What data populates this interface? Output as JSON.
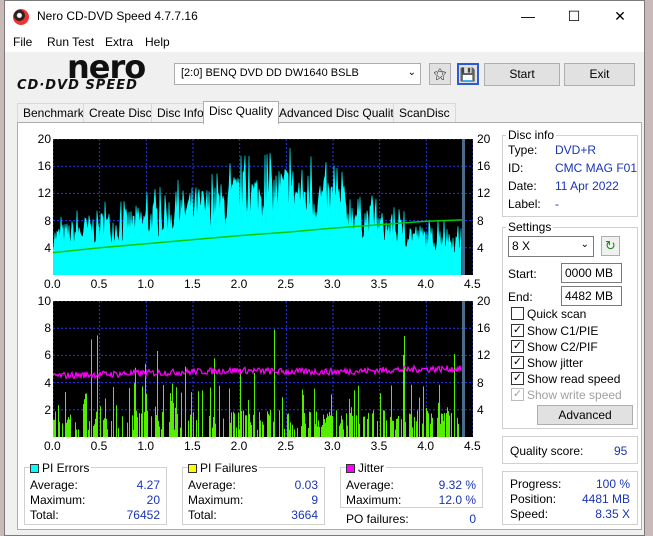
{
  "window": {
    "title": "Nero CD-DVD Speed 4.7.7.16"
  },
  "menu": [
    "File",
    "Run Test",
    "Extra",
    "Help"
  ],
  "logo": {
    "top": "nero",
    "bottom": "CD·DVD SPEED"
  },
  "toolbar": {
    "drive": "[2:0]  BENQ DVD DD DW1640 BSLB",
    "start_label": "Start",
    "exit_label": "Exit"
  },
  "tabs": [
    "Benchmark",
    "Create Disc",
    "Disc Info",
    "Disc Quality",
    "Advanced Disc Quality",
    "ScanDisc"
  ],
  "active_tab": "Disc Quality",
  "disc_info": {
    "title": "Disc info",
    "type_label": "Type:",
    "type": "DVD+R",
    "id_label": "ID:",
    "id": "CMC MAG F01",
    "date_label": "Date:",
    "date": "11 Apr 2022",
    "label_label": "Label:",
    "label": "-"
  },
  "settings": {
    "title": "Settings",
    "speed": "8 X",
    "start_label": "Start:",
    "start": "0000 MB",
    "end_label": "End:",
    "end": "4482 MB",
    "quick_scan": "Quick scan",
    "show_c1pie": "Show C1/PIE",
    "show_c2pif": "Show C2/PIF",
    "show_jitter": "Show jitter",
    "show_read_speed": "Show read speed",
    "show_write_speed": "Show write speed",
    "advanced_label": "Advanced"
  },
  "checks": {
    "quick_scan": false,
    "show_c1pie": true,
    "show_c2pif": true,
    "show_jitter": true,
    "show_read_speed": true,
    "show_write_speed": true
  },
  "quality": {
    "label": "Quality score:",
    "value": "95"
  },
  "progress": {
    "progress_label": "Progress:",
    "progress": "100 %",
    "position_label": "Position:",
    "position": "4481 MB",
    "speed_label": "Speed:",
    "speed": "8.35 X"
  },
  "stats": {
    "pi_errors": {
      "title": "PI Errors",
      "avg_label": "Average:",
      "avg": "4.27",
      "max_label": "Maximum:",
      "max": "20",
      "total_label": "Total:",
      "total": "76452"
    },
    "pi_failures": {
      "title": "PI Failures",
      "avg_label": "Average:",
      "avg": "0.03",
      "max_label": "Maximum:",
      "max": "9",
      "total_label": "Total:",
      "total": "3664"
    },
    "jitter": {
      "title": "Jitter",
      "avg_label": "Average:",
      "avg": "9.32 %",
      "max_label": "Maximum:",
      "max": "12.0 %"
    },
    "po_failures_label": "PO failures:",
    "po_failures": "0"
  },
  "colors": {
    "pie": "#00ffff",
    "pif": "#55ee00",
    "jitter": "#ff00ff",
    "speed": "#00cc00",
    "grid": "#2233ff",
    "plot_bg": "#000000"
  },
  "chart_data": [
    {
      "type": "area",
      "name": "PI Errors",
      "xlim": [
        0,
        4.5
      ],
      "ylim_left": [
        0,
        20
      ],
      "ylim_right": [
        0,
        20
      ],
      "x_ticks": [
        "0.0",
        "0.5",
        "1.0",
        "1.5",
        "2.0",
        "2.5",
        "3.0",
        "3.5",
        "4.0",
        "4.5"
      ],
      "y_ticks_left": [
        "20",
        "16",
        "12",
        "8",
        "4"
      ],
      "y_ticks_right": [
        "20",
        "16",
        "12",
        "8",
        "4"
      ],
      "pie_envelope": {
        "x": [
          0,
          0.25,
          0.5,
          0.75,
          1.0,
          1.25,
          1.5,
          1.75,
          2.0,
          2.25,
          2.5,
          2.75,
          3.0,
          3.25,
          3.5,
          3.75,
          4.0,
          4.25,
          4.38
        ],
        "y": [
          6,
          7,
          8,
          8,
          9,
          10,
          11,
          11,
          13,
          13,
          14,
          13,
          12,
          10,
          8,
          7,
          6,
          6,
          5
        ]
      },
      "read_speed": {
        "x": [
          0,
          0.5,
          1.0,
          1.5,
          2.0,
          2.5,
          3.0,
          3.5,
          4.0,
          4.38
        ],
        "y": [
          3.3,
          4.0,
          4.6,
          5.2,
          5.8,
          6.3,
          6.9,
          7.4,
          7.9,
          8.1
        ]
      }
    },
    {
      "type": "bar",
      "name": "PI Failures",
      "xlim": [
        0,
        4.5
      ],
      "ylim_left": [
        0,
        10
      ],
      "ylim_right": [
        0,
        20
      ],
      "x_ticks": [
        "0.0",
        "0.5",
        "1.0",
        "1.5",
        "2.0",
        "2.5",
        "3.0",
        "3.5",
        "4.0",
        "4.5"
      ],
      "y_ticks_left": [
        "10",
        "8",
        "6",
        "4",
        "2"
      ],
      "y_ticks_right": [
        "20",
        "16",
        "12",
        "8",
        "4"
      ],
      "jitter": {
        "x": [
          0,
          0.5,
          1.0,
          1.5,
          2.0,
          2.5,
          3.0,
          3.5,
          4.0,
          4.38
        ],
        "y": [
          4.5,
          4.6,
          4.7,
          4.8,
          4.9,
          4.8,
          4.8,
          4.9,
          5.0,
          5.0
        ]
      }
    }
  ]
}
